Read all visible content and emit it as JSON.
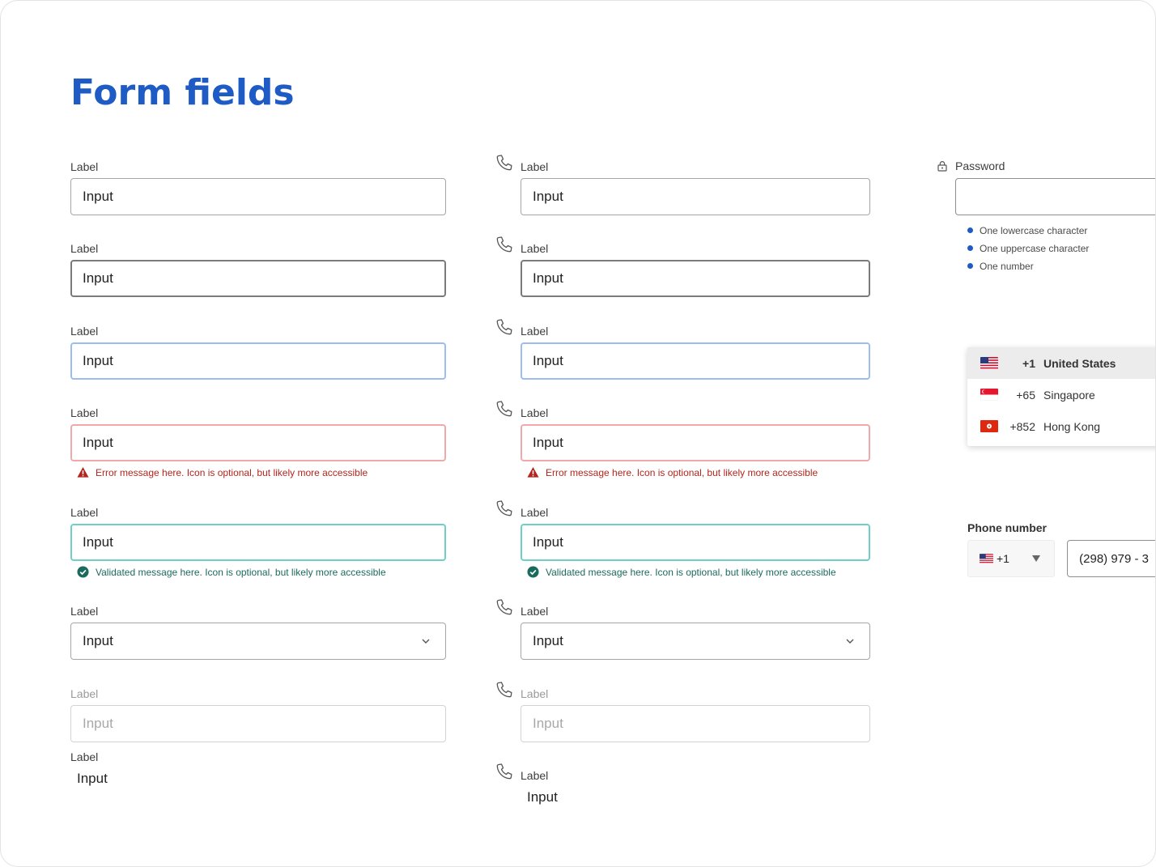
{
  "page": {
    "title": "Form fields"
  },
  "fields": {
    "default_label": "Label",
    "default_value": "Input",
    "error_message": "Error message here. Icon is optional, but likely more accessible",
    "valid_message": "Validated message here. Icon is optional, but likely more accessible"
  },
  "password": {
    "label": "Password",
    "rules": [
      {
        "text": "One lowercase character",
        "met": true
      },
      {
        "text": "One uppercase character",
        "met": true
      },
      {
        "text": "One number",
        "met": false
      }
    ]
  },
  "country_dropdown": {
    "items": [
      {
        "code": "+1",
        "country": "United States",
        "flag": "us-flag-icon",
        "selected": true
      },
      {
        "code": "+65",
        "country": "Singapore",
        "flag": "sg-flag-icon",
        "selected": false
      },
      {
        "code": "+852",
        "country": "Hong Kong",
        "flag": "hk-flag-icon",
        "selected": false
      }
    ]
  },
  "phone": {
    "label": "Phone number",
    "country_code": "+1",
    "value": "(298) 979 - 3"
  },
  "colors": {
    "title": "#1f5bc4",
    "focus_border": "#9dbdf0",
    "error_border": "#f2a8a8",
    "error_text": "#b3261e",
    "valid_border": "#6fcfc6",
    "valid_text": "#1a6b5e",
    "rule_met": "#1f5bc4",
    "rule_unmet": "#cfcfcf"
  }
}
